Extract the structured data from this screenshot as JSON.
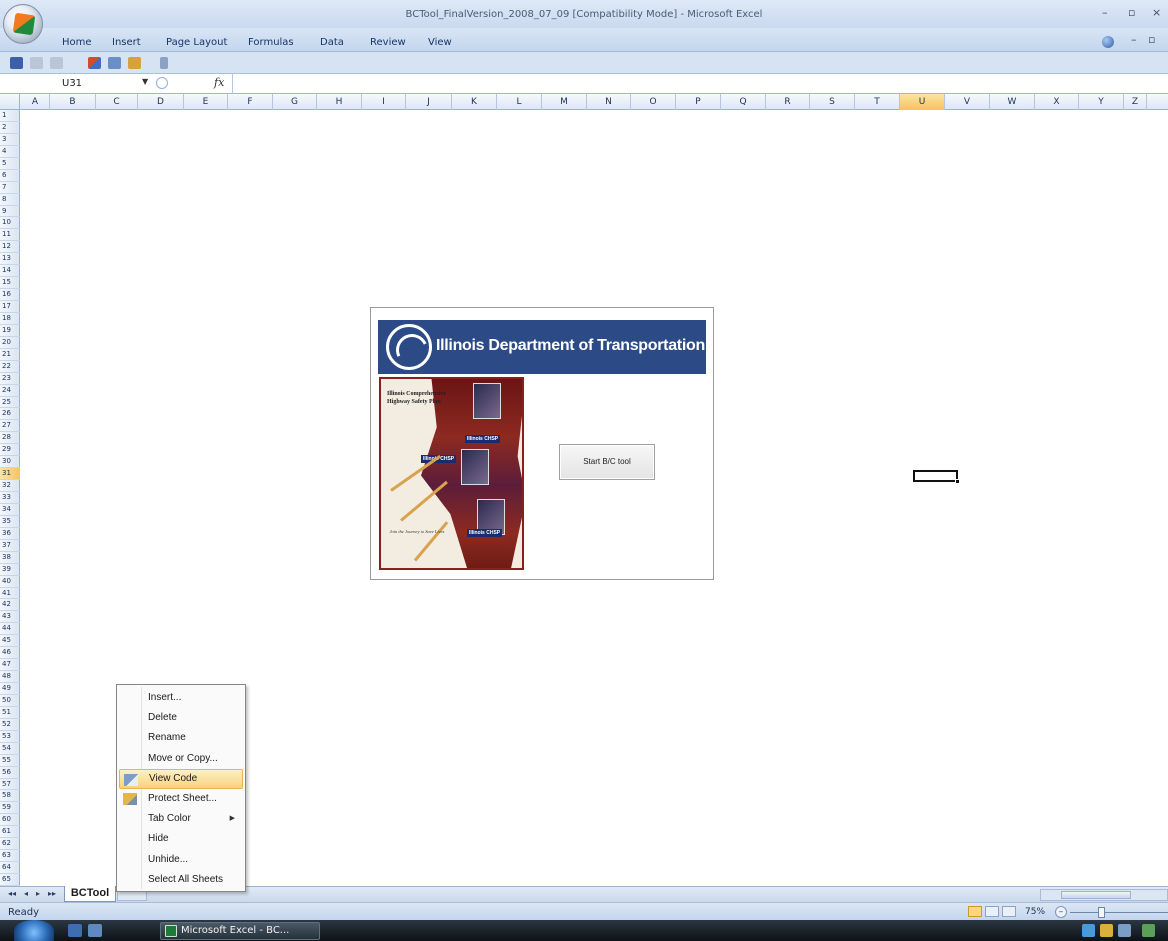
{
  "window": {
    "title": "BCTool_FinalVersion_2008_07_09  [Compatibility Mode] - Microsoft Excel",
    "controls": [
      "–",
      "▫",
      "×"
    ],
    "ribbon_controls": [
      "–",
      "▫"
    ]
  },
  "ribbon": {
    "tabs": [
      "Home",
      "Insert",
      "Page Layout",
      "Formulas",
      "Data",
      "Review",
      "View"
    ]
  },
  "formula_bar": {
    "name_box": "U31",
    "fx_label": "fx",
    "formula": ""
  },
  "grid": {
    "columns": [
      "A",
      "B",
      "C",
      "D",
      "E",
      "F",
      "G",
      "H",
      "I",
      "J",
      "K",
      "L",
      "M",
      "N",
      "O",
      "P",
      "Q",
      "R",
      "S",
      "T",
      "U",
      "V",
      "W",
      "X",
      "Y",
      "Z"
    ],
    "rows": [
      "1",
      "2",
      "3",
      "4",
      "5",
      "6",
      "7",
      "8",
      "9",
      "10",
      "11",
      "12",
      "13",
      "14",
      "15",
      "16",
      "17",
      "18",
      "19",
      "20",
      "21",
      "22",
      "23",
      "24",
      "25",
      "26",
      "27",
      "28",
      "29",
      "30",
      "31",
      "32",
      "33",
      "34",
      "35",
      "36",
      "37",
      "38",
      "39",
      "40",
      "41",
      "42",
      "43",
      "44",
      "45",
      "46",
      "47",
      "48",
      "49",
      "50",
      "51",
      "52",
      "53",
      "54",
      "55",
      "56",
      "57",
      "58",
      "59",
      "60",
      "61",
      "62",
      "63",
      "64",
      "65"
    ],
    "selected_column": "U",
    "selected_row": "31"
  },
  "panel": {
    "banner_title": "Illinois Department of Transportation",
    "cover_title": "Illinois Comprehensive Highway Safety Plan",
    "cover_badge": "Illinois CHSP",
    "cover_footer": "Join the Journey to Save Lives",
    "start_button": "Start B/C tool"
  },
  "sheet_tabs": {
    "nav": [
      "◂◂",
      "◂",
      "▸",
      "▸▸"
    ],
    "active": "BCTool"
  },
  "context_menu": {
    "items": [
      {
        "label": "Insert...",
        "highlighted": false,
        "submenu": false,
        "icon": ""
      },
      {
        "label": "Delete",
        "highlighted": false,
        "submenu": false,
        "icon": ""
      },
      {
        "label": "Rename",
        "highlighted": false,
        "submenu": false,
        "icon": ""
      },
      {
        "label": "Move or Copy...",
        "highlighted": false,
        "submenu": false,
        "icon": ""
      },
      {
        "label": "View Code",
        "highlighted": true,
        "submenu": false,
        "icon": "view-code-icon"
      },
      {
        "label": "Protect Sheet...",
        "highlighted": false,
        "submenu": false,
        "icon": "protect-sheet-icon"
      },
      {
        "label": "Tab Color",
        "highlighted": false,
        "submenu": true,
        "icon": ""
      },
      {
        "label": "Hide",
        "highlighted": false,
        "submenu": false,
        "icon": ""
      },
      {
        "label": "Unhide...",
        "highlighted": false,
        "submenu": false,
        "icon": ""
      },
      {
        "label": "Select All Sheets",
        "highlighted": false,
        "submenu": false,
        "icon": ""
      }
    ]
  },
  "status_bar": {
    "status": "Ready",
    "zoom": "75%",
    "zoom_minus": "–"
  },
  "taskbar": {
    "task_button": "Microsoft Excel - BC..."
  },
  "colors": {
    "ribbon_bg": "#c9d9ef",
    "idot_blue": "#2c4a85",
    "selection_orange": "#f6c35e",
    "menu_highlight": "#f8d27a"
  }
}
